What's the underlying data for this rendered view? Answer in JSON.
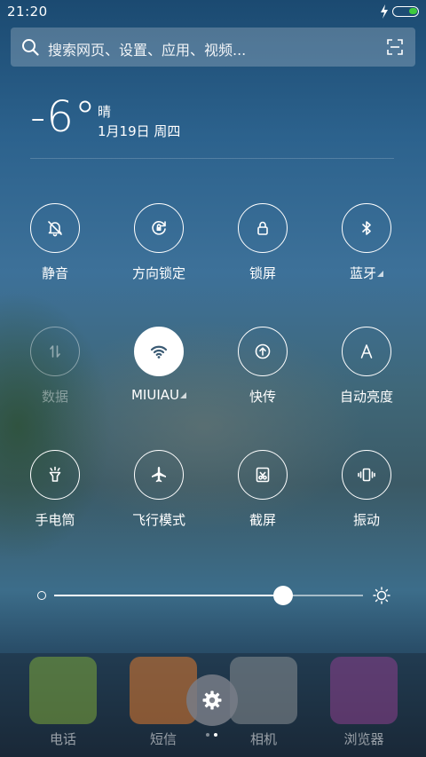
{
  "status_bar": {
    "time": "21:20",
    "battery_color": "#3ecb3e"
  },
  "search": {
    "placeholder": "搜索网页、设置、应用、视频..."
  },
  "weather": {
    "temperature": "-6°",
    "condition": "晴",
    "date": "1月19日 周四"
  },
  "toggles": [
    {
      "label": "静音",
      "icon": "bell-mute-icon",
      "state": "off"
    },
    {
      "label": "方向锁定",
      "icon": "rotation-lock-icon",
      "state": "off"
    },
    {
      "label": "锁屏",
      "icon": "lock-icon",
      "state": "off"
    },
    {
      "label": "蓝牙",
      "icon": "bluetooth-icon",
      "state": "off",
      "has_submenu": true
    },
    {
      "label": "数据",
      "icon": "mobile-data-icon",
      "state": "disabled"
    },
    {
      "label": "MIUIAU",
      "icon": "wifi-icon",
      "state": "on",
      "has_submenu": true
    },
    {
      "label": "快传",
      "icon": "quick-transfer-icon",
      "state": "off"
    },
    {
      "label": "自动亮度",
      "icon": "auto-brightness-icon",
      "state": "off"
    },
    {
      "label": "手电筒",
      "icon": "flashlight-icon",
      "state": "off"
    },
    {
      "label": "飞行模式",
      "icon": "airplane-icon",
      "state": "off"
    },
    {
      "label": "截屏",
      "icon": "screenshot-icon",
      "state": "off"
    },
    {
      "label": "振动",
      "icon": "vibrate-icon",
      "state": "off"
    }
  ],
  "brightness": {
    "level": 0.74
  },
  "dock": {
    "apps": [
      {
        "label": "电话",
        "icon": "phone-app-icon",
        "color": "#7ea83a"
      },
      {
        "label": "短信",
        "icon": "message-app-icon",
        "color": "#e07a2e"
      },
      {
        "label": "相机",
        "icon": "camera-app-icon",
        "color": "#8a8f93"
      },
      {
        "label": "浏览器",
        "icon": "browser-app-icon",
        "color": "#8e3f8e"
      }
    ],
    "page_count": 2,
    "active_page": 2
  }
}
